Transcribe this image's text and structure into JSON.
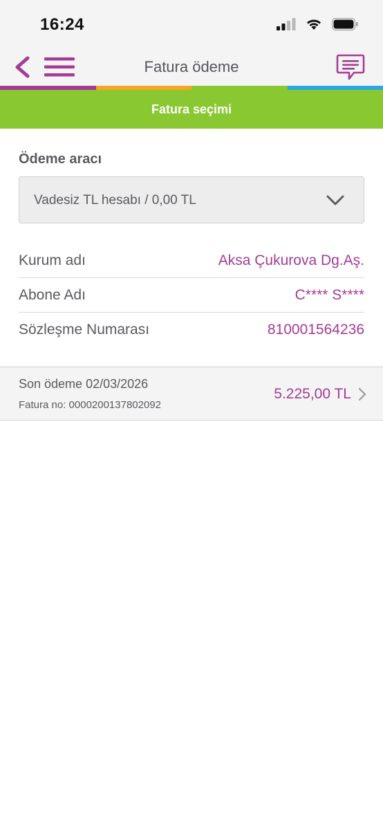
{
  "status_bar": {
    "time": "16:24",
    "icons": [
      "signal-icon",
      "wifi-icon",
      "battery-icon"
    ]
  },
  "nav": {
    "title": "Fatura ödeme",
    "icons": [
      "back-chevron-icon",
      "hamburger-menu-icon",
      "chat-icon"
    ]
  },
  "colors": {
    "brand_purple": "#a33c94",
    "step_green": "#8ac832",
    "stripe": [
      "#a33c94",
      "#f5a623",
      "#8ac832",
      "#2ca8e0"
    ]
  },
  "step": {
    "label": "Fatura seçimi"
  },
  "payment_method": {
    "label": "Ödeme aracı",
    "selected": "Vadesiz TL hesabı / 0,00 TL"
  },
  "details": [
    {
      "label": "Kurum adı",
      "value": "Aksa Çukurova Dg.Aş."
    },
    {
      "label": "Abone Adı",
      "value": "C**** S****"
    },
    {
      "label": "Sözleşme Numarası",
      "value": "810001564236"
    }
  ],
  "bill": {
    "due_text": "Son ödeme 02/03/2026",
    "bill_no_text": "Fatura no: 0000200137802092",
    "amount": "5.225,00 TL"
  }
}
